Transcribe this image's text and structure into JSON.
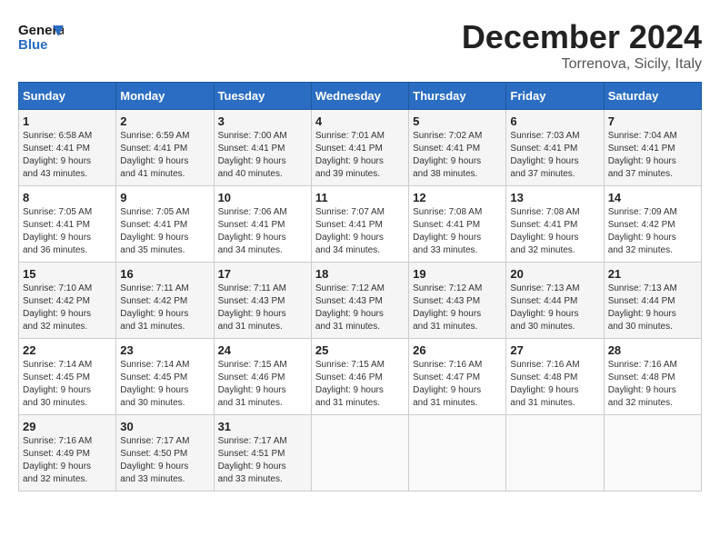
{
  "logo": {
    "line1": "General",
    "line2": "Blue"
  },
  "title": "December 2024",
  "location": "Torrenova, Sicily, Italy",
  "days_of_week": [
    "Sunday",
    "Monday",
    "Tuesday",
    "Wednesday",
    "Thursday",
    "Friday",
    "Saturday"
  ],
  "weeks": [
    [
      {
        "day": 1,
        "info": "Sunrise: 6:58 AM\nSunset: 4:41 PM\nDaylight: 9 hours\nand 43 minutes."
      },
      {
        "day": 2,
        "info": "Sunrise: 6:59 AM\nSunset: 4:41 PM\nDaylight: 9 hours\nand 41 minutes."
      },
      {
        "day": 3,
        "info": "Sunrise: 7:00 AM\nSunset: 4:41 PM\nDaylight: 9 hours\nand 40 minutes."
      },
      {
        "day": 4,
        "info": "Sunrise: 7:01 AM\nSunset: 4:41 PM\nDaylight: 9 hours\nand 39 minutes."
      },
      {
        "day": 5,
        "info": "Sunrise: 7:02 AM\nSunset: 4:41 PM\nDaylight: 9 hours\nand 38 minutes."
      },
      {
        "day": 6,
        "info": "Sunrise: 7:03 AM\nSunset: 4:41 PM\nDaylight: 9 hours\nand 37 minutes."
      },
      {
        "day": 7,
        "info": "Sunrise: 7:04 AM\nSunset: 4:41 PM\nDaylight: 9 hours\nand 37 minutes."
      }
    ],
    [
      {
        "day": 8,
        "info": "Sunrise: 7:05 AM\nSunset: 4:41 PM\nDaylight: 9 hours\nand 36 minutes."
      },
      {
        "day": 9,
        "info": "Sunrise: 7:05 AM\nSunset: 4:41 PM\nDaylight: 9 hours\nand 35 minutes."
      },
      {
        "day": 10,
        "info": "Sunrise: 7:06 AM\nSunset: 4:41 PM\nDaylight: 9 hours\nand 34 minutes."
      },
      {
        "day": 11,
        "info": "Sunrise: 7:07 AM\nSunset: 4:41 PM\nDaylight: 9 hours\nand 34 minutes."
      },
      {
        "day": 12,
        "info": "Sunrise: 7:08 AM\nSunset: 4:41 PM\nDaylight: 9 hours\nand 33 minutes."
      },
      {
        "day": 13,
        "info": "Sunrise: 7:08 AM\nSunset: 4:41 PM\nDaylight: 9 hours\nand 32 minutes."
      },
      {
        "day": 14,
        "info": "Sunrise: 7:09 AM\nSunset: 4:42 PM\nDaylight: 9 hours\nand 32 minutes."
      }
    ],
    [
      {
        "day": 15,
        "info": "Sunrise: 7:10 AM\nSunset: 4:42 PM\nDaylight: 9 hours\nand 32 minutes."
      },
      {
        "day": 16,
        "info": "Sunrise: 7:11 AM\nSunset: 4:42 PM\nDaylight: 9 hours\nand 31 minutes."
      },
      {
        "day": 17,
        "info": "Sunrise: 7:11 AM\nSunset: 4:43 PM\nDaylight: 9 hours\nand 31 minutes."
      },
      {
        "day": 18,
        "info": "Sunrise: 7:12 AM\nSunset: 4:43 PM\nDaylight: 9 hours\nand 31 minutes."
      },
      {
        "day": 19,
        "info": "Sunrise: 7:12 AM\nSunset: 4:43 PM\nDaylight: 9 hours\nand 31 minutes."
      },
      {
        "day": 20,
        "info": "Sunrise: 7:13 AM\nSunset: 4:44 PM\nDaylight: 9 hours\nand 30 minutes."
      },
      {
        "day": 21,
        "info": "Sunrise: 7:13 AM\nSunset: 4:44 PM\nDaylight: 9 hours\nand 30 minutes."
      }
    ],
    [
      {
        "day": 22,
        "info": "Sunrise: 7:14 AM\nSunset: 4:45 PM\nDaylight: 9 hours\nand 30 minutes."
      },
      {
        "day": 23,
        "info": "Sunrise: 7:14 AM\nSunset: 4:45 PM\nDaylight: 9 hours\nand 30 minutes."
      },
      {
        "day": 24,
        "info": "Sunrise: 7:15 AM\nSunset: 4:46 PM\nDaylight: 9 hours\nand 31 minutes."
      },
      {
        "day": 25,
        "info": "Sunrise: 7:15 AM\nSunset: 4:46 PM\nDaylight: 9 hours\nand 31 minutes."
      },
      {
        "day": 26,
        "info": "Sunrise: 7:16 AM\nSunset: 4:47 PM\nDaylight: 9 hours\nand 31 minutes."
      },
      {
        "day": 27,
        "info": "Sunrise: 7:16 AM\nSunset: 4:48 PM\nDaylight: 9 hours\nand 31 minutes."
      },
      {
        "day": 28,
        "info": "Sunrise: 7:16 AM\nSunset: 4:48 PM\nDaylight: 9 hours\nand 32 minutes."
      }
    ],
    [
      {
        "day": 29,
        "info": "Sunrise: 7:16 AM\nSunset: 4:49 PM\nDaylight: 9 hours\nand 32 minutes."
      },
      {
        "day": 30,
        "info": "Sunrise: 7:17 AM\nSunset: 4:50 PM\nDaylight: 9 hours\nand 33 minutes."
      },
      {
        "day": 31,
        "info": "Sunrise: 7:17 AM\nSunset: 4:51 PM\nDaylight: 9 hours\nand 33 minutes."
      },
      null,
      null,
      null,
      null
    ]
  ]
}
